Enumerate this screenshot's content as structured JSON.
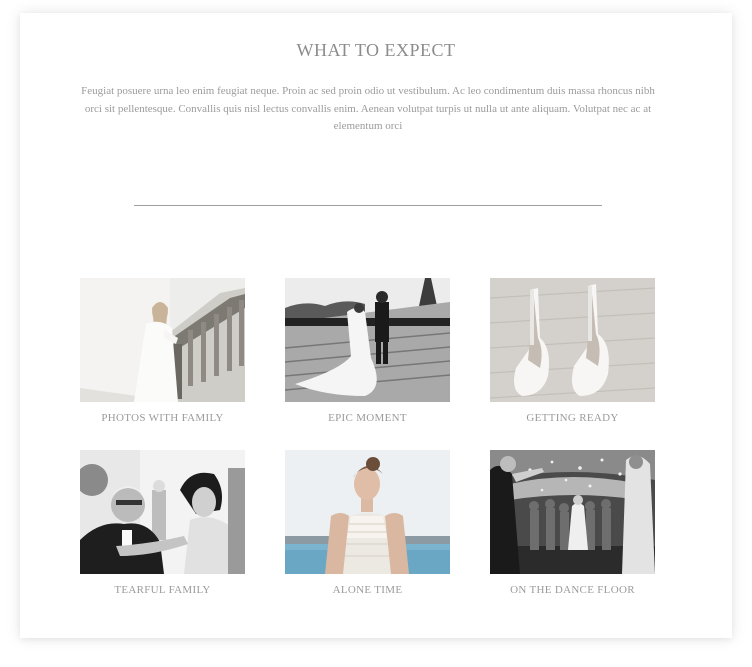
{
  "section": {
    "title": "WHAT TO EXPECT",
    "intro": "Feugiat posuere urna leo enim feugiat neque. Proin ac sed proin odio ut vestibulum. Ac leo condimentum duis massa rhoncus nibh orci sit pellentesque. Convallis quis nisl lectus convallis enim. Aenean volutpat turpis ut nulla ut ante aliquam. Volutpat nec ac at elementum orci"
  },
  "gallery": {
    "items": [
      {
        "caption": "PHOTOS WITH FAMILY",
        "image": "bride-on-staircase-photo"
      },
      {
        "caption": "EPIC MOMENT",
        "image": "couple-near-eiffel-tower-photo"
      },
      {
        "caption": "GETTING READY",
        "image": "white-heels-photo"
      },
      {
        "caption": "TEARFUL FAMILY",
        "image": "father-and-bride-photo"
      },
      {
        "caption": "ALONE TIME",
        "image": "bride-by-the-sea-photo"
      },
      {
        "caption": "ON THE DANCE FLOOR",
        "image": "dance-floor-photo"
      }
    ]
  },
  "colors": {
    "heading": "#8c8c8c",
    "body_text": "#9b9b9b",
    "divider": "#9e9e9e",
    "card_background": "#ffffff"
  }
}
